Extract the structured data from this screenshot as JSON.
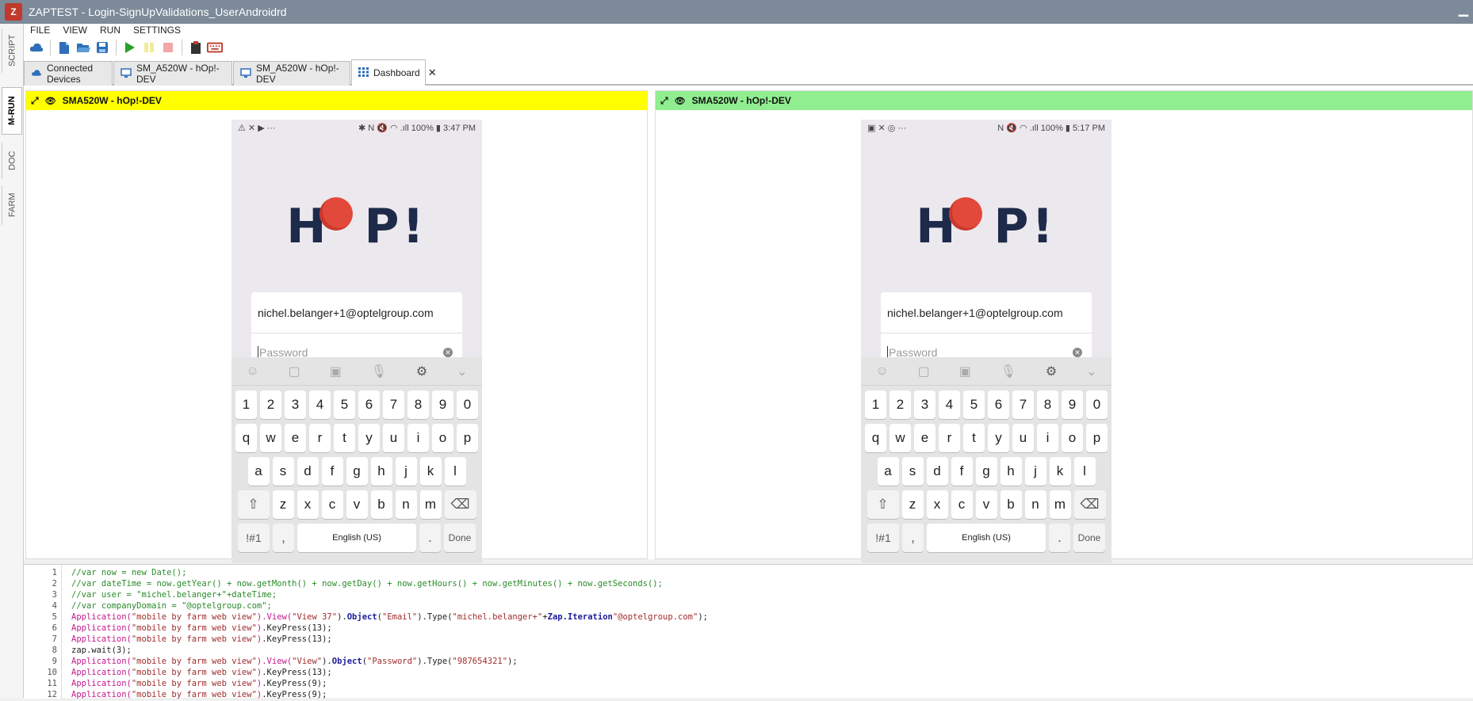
{
  "window": {
    "title": "ZAPTEST - Login-SignUpValidations_UserAndroidrd",
    "logo": "Z"
  },
  "sidebar": {
    "tabs": [
      "SCRIPT",
      "M-RUN",
      "DOC",
      "FARM"
    ],
    "active": "M-RUN"
  },
  "menu": [
    "FILE",
    "VIEW",
    "RUN",
    "SETTINGS"
  ],
  "tabs": [
    {
      "label": "Connected Devices",
      "icon": "cloud-icon"
    },
    {
      "label": "SM_A520W - hOp!-DEV",
      "icon": "monitor-icon"
    },
    {
      "label": "SM_A520W - hOp!-DEV",
      "icon": "monitor-icon"
    },
    {
      "label": "Dashboard",
      "icon": "grid-icon",
      "close": "✕"
    }
  ],
  "devices": [
    {
      "title": "SMA520W - hOp!-DEV",
      "header_color": "#ffff00",
      "status_left": "⚠ ✕ ▶ ···",
      "status_right": "✱ N 🔇 ◠ .ıll 100% ▮ 3:47 PM",
      "email": "nichel.belanger+1@optelgroup.com",
      "password_placeholder": "Password"
    },
    {
      "title": "SMA520W - hOp!-DEV",
      "header_color": "#90ee90",
      "status_left": "▣ ✕ ◎ ···",
      "status_right": "N 🔇 ◠ .ıll 100% ▮ 5:17 PM",
      "email": "nichel.belanger+1@optelgroup.com",
      "password_placeholder": "Password"
    }
  ],
  "app": {
    "logo_left": "H",
    "logo_right": "P!"
  },
  "keyboard": {
    "row_numbers": [
      "1",
      "2",
      "3",
      "4",
      "5",
      "6",
      "7",
      "8",
      "9",
      "0"
    ],
    "row1": [
      "q",
      "w",
      "e",
      "r",
      "t",
      "y",
      "u",
      "i",
      "o",
      "p"
    ],
    "row2": [
      "a",
      "s",
      "d",
      "f",
      "g",
      "h",
      "j",
      "k",
      "l"
    ],
    "row3": [
      "z",
      "x",
      "c",
      "v",
      "b",
      "n",
      "m"
    ],
    "shift": "⇧",
    "backspace": "⌫",
    "symbols": "!#1",
    "comma": ",",
    "space": "English (US)",
    "period": ".",
    "done": "Done"
  },
  "code": [
    {
      "n": "1",
      "parts": [
        [
          "c-comment",
          "//var now = new Date();"
        ]
      ]
    },
    {
      "n": "2",
      "parts": [
        [
          "c-comment",
          "//var dateTime = now.getYear() + now.getMonth() + now.getDay() + now.getHours() + now.getMinutes() + now.getSeconds();"
        ]
      ]
    },
    {
      "n": "3",
      "parts": [
        [
          "c-comment",
          "//var user = \"michel.belanger+\"+dateTime;"
        ]
      ]
    },
    {
      "n": "4",
      "parts": [
        [
          "c-comment",
          "//var companyDomain = \"@optelgroup.com\";"
        ]
      ]
    },
    {
      "n": "5",
      "parts": [
        [
          "c-app",
          "Application("
        ],
        [
          "c-str",
          "\"mobile by farm web view\""
        ],
        [
          "c-app",
          ").View("
        ],
        [
          "c-str",
          "\"View 37\""
        ],
        [
          "c-plain",
          ")."
        ],
        [
          "c-obj",
          "Object"
        ],
        [
          "c-plain",
          "("
        ],
        [
          "c-str",
          "\"Email\""
        ],
        [
          "c-plain",
          ").Type("
        ],
        [
          "c-str",
          "\"michel.belanger+\""
        ],
        [
          "c-plain",
          "+"
        ],
        [
          "c-obj",
          "Zap.Iteration"
        ],
        [
          "c-str",
          "\"@optelgroup.com\""
        ],
        [
          "c-plain",
          ");"
        ]
      ]
    },
    {
      "n": "6",
      "parts": [
        [
          "c-app",
          "Application("
        ],
        [
          "c-str",
          "\"mobile by farm web view\""
        ],
        [
          "c-app",
          ")"
        ],
        [
          "c-plain",
          ".KeyPress(13);"
        ]
      ]
    },
    {
      "n": "7",
      "parts": [
        [
          "c-app",
          "Application("
        ],
        [
          "c-str",
          "\"mobile by farm web view\""
        ],
        [
          "c-app",
          ")"
        ],
        [
          "c-plain",
          ".KeyPress(13);"
        ]
      ]
    },
    {
      "n": "8",
      "parts": [
        [
          "c-plain",
          "zap.wait(3);"
        ]
      ]
    },
    {
      "n": "9",
      "parts": [
        [
          "c-app",
          "Application("
        ],
        [
          "c-str",
          "\"mobile by farm web view\""
        ],
        [
          "c-app",
          ").View("
        ],
        [
          "c-str",
          "\"View\""
        ],
        [
          "c-plain",
          ")."
        ],
        [
          "c-obj",
          "Object"
        ],
        [
          "c-plain",
          "("
        ],
        [
          "c-str",
          "\"Password\""
        ],
        [
          "c-plain",
          ").Type("
        ],
        [
          "c-str",
          "\"987654321\""
        ],
        [
          "c-plain",
          ");"
        ]
      ]
    },
    {
      "n": "10",
      "parts": [
        [
          "c-app",
          "Application("
        ],
        [
          "c-str",
          "\"mobile by farm web view\""
        ],
        [
          "c-app",
          ")"
        ],
        [
          "c-plain",
          ".KeyPress(13);"
        ]
      ]
    },
    {
      "n": "11",
      "parts": [
        [
          "c-app",
          "Application("
        ],
        [
          "c-str",
          "\"mobile by farm web view\""
        ],
        [
          "c-app",
          ")"
        ],
        [
          "c-plain",
          ".KeyPress(9);"
        ]
      ]
    },
    {
      "n": "12",
      "parts": [
        [
          "c-app",
          "Application("
        ],
        [
          "c-str",
          "\"mobile by farm web view\""
        ],
        [
          "c-app",
          ")"
        ],
        [
          "c-plain",
          ".KeyPress(9);"
        ]
      ]
    }
  ]
}
